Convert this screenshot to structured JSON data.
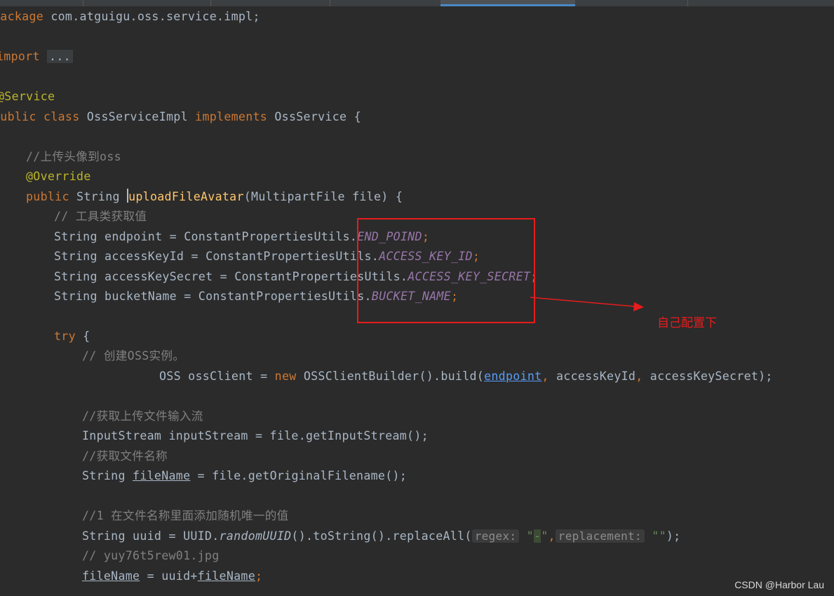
{
  "code": {
    "package_kw": "package",
    "package_name": " com.atguigu.oss.service.impl;",
    "import_kw": "import",
    "import_fold": "...",
    "annotation_service": "@Service",
    "class_public": "public",
    "class_kw": "class",
    "class_name": "OssServiceImpl",
    "implements_kw": "implements",
    "iface_name": "OssService {",
    "comment_upload": "//上传头像到oss",
    "annotation_override": "@Override",
    "method_public": "public",
    "method_ret": "String",
    "method_name": "uploadFileAvatar",
    "method_params": "(MultipartFile file) {",
    "comment_tools": "// 工具类获取值",
    "endpoint_decl": "String endpoint = ConstantPropertiesUtils.",
    "endpoint_const": "END_POIND",
    "accesskeyid_decl": "String accessKeyId = ConstantPropertiesUtils.",
    "accesskeyid_const": "ACCESS_KEY_ID",
    "accesskeysecret_decl": "String accessKeySecret = ConstantPropertiesUtils.",
    "accesskeysecret_const": "ACCESS_KEY_SECRET",
    "bucketname_decl": "String bucketName = ConstantPropertiesUtils.",
    "bucketname_const": "BUCKET_NAME",
    "semicolon": ";",
    "try_kw": "try",
    "try_brace": " {",
    "comment_create": "// 创建OSS实例。",
    "oss_decl": "OSS ossClient = ",
    "new_kw": "new",
    "oss_builder": " OSSClientBuilder().build(",
    "arg_endpoint": "endpoint",
    "comma": ",",
    "arg_accesskeyid": " accessKeyId",
    "arg_accesskeysecret": " accessKeySecret);",
    "comment_stream": "//获取上传文件输入流",
    "stream_decl": "InputStream inputStream = file.getInputStream();",
    "comment_filename": "//获取文件名称",
    "filename_type": "String ",
    "filename_var": "fileName",
    "filename_rest": " = file.getOriginalFilename();",
    "comment_uuid": "//1 在文件名称里面添加随机唯一的值",
    "uuid_decl": "String uuid = UUID.",
    "uuid_method": "randomUUID",
    "uuid_rest": "().toString().replaceAll(",
    "hint_regex": "regex:",
    "str_dash_open": " \"",
    "str_dash_char": "-",
    "str_dash_close": "\"",
    "hint_replacement": "replacement:",
    "str_empty": " \"\"",
    "uuid_end": ");",
    "comment_example": "// yuy76t5rew01.jpg",
    "assign_filename": "fileName",
    "assign_eq": " = uuid+",
    "assign_filename2": "fileName"
  },
  "annotation": {
    "note": "自己配置下",
    "box_color": "#e81c1c"
  },
  "watermark": "CSDN @Harbor Lau"
}
